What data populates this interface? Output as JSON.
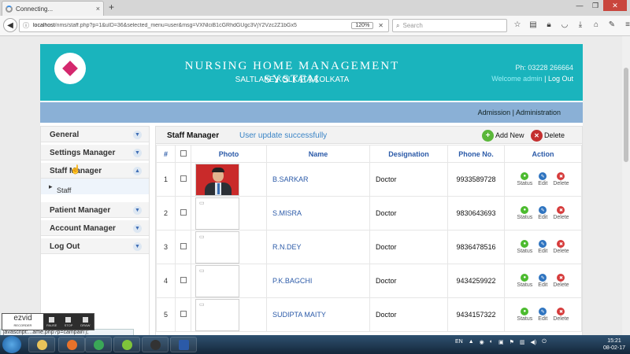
{
  "browser": {
    "tab_title": "Connecting...",
    "tab_close": "×",
    "new_tab": "+",
    "url_host": "localhost",
    "url_path": "/nms/staff.php?p=1&uID=36&selected_menu=user&msg=VXNlciB1cGRhdGUgc3VjY2Vzc2Z1bGx5",
    "zoom": "120%",
    "search_placeholder": "Search",
    "win_min": "—",
    "win_max": "❐",
    "win_close": "✕"
  },
  "header": {
    "title": "NURSING HOME MANAGEMENT SYSTEM",
    "subtitle": "SALTLAKE,KOLKATA,KOLKATA",
    "phone": "Ph:   03228 266664",
    "welcome": "Welcome admin",
    "logout": "Log Out"
  },
  "adminbar": {
    "text": "Admission | Administration"
  },
  "sidebar": {
    "items": [
      {
        "label": "General"
      },
      {
        "label": "Settings Manager"
      },
      {
        "label": "Staff Manager"
      },
      {
        "label": "Patient Manager"
      },
      {
        "label": "Account Manager"
      },
      {
        "label": "Log Out"
      }
    ],
    "submenu": {
      "label": "Staff"
    }
  },
  "content": {
    "title": "Staff Manager",
    "message": "User update successfully",
    "add_label": "Add New",
    "delete_label": "Delete"
  },
  "table": {
    "headers": {
      "num": "#",
      "photo": "Photo",
      "name": "Name",
      "designation": "Designation",
      "phone": "Phone No.",
      "action": "Action"
    },
    "actions": {
      "status": "Status",
      "edit": "Edit",
      "delete": "Delete"
    },
    "rows": [
      {
        "num": "1",
        "name": "B.SARKAR",
        "designation": "Doctor",
        "phone": "9933589728"
      },
      {
        "num": "2",
        "name": "S.MISRA",
        "designation": "Doctor",
        "phone": "9830643693"
      },
      {
        "num": "3",
        "name": "R.N.DEY",
        "designation": "Doctor",
        "phone": "9836478516"
      },
      {
        "num": "4",
        "name": "P.K.BAGCHI",
        "designation": "Doctor",
        "phone": "9434259922"
      },
      {
        "num": "5",
        "name": "SUDIPTA MAITY",
        "designation": "Doctor",
        "phone": "9434157322"
      }
    ]
  },
  "overlay": {
    "status_url": "javascript:...ame.php?p=campain');",
    "ezvid_brand": "ezvid",
    "ezvid_sub": "RECORDER",
    "ezvid_pause": "PAUSE",
    "ezvid_stop": "STOP",
    "ezvid_draw": "DRAW"
  },
  "taskbar": {
    "lang": "EN",
    "time": "15:21",
    "date": "08-02-17"
  },
  "colors": {
    "header_bg": "#1ab4bd",
    "adminbar_bg": "#8ab0d6",
    "link_blue": "#2b5aa8",
    "success_msg": "#3a84c6"
  }
}
